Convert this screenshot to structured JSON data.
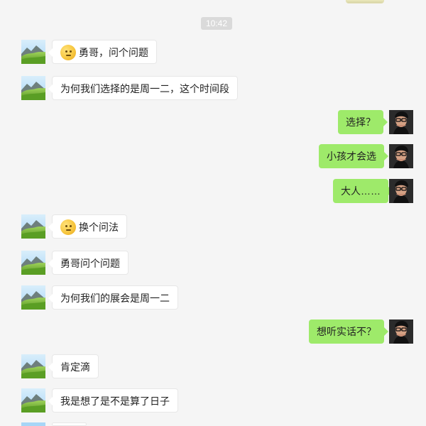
{
  "window": {
    "title": "WeChat chat",
    "timestamp": "10:42"
  },
  "messages": [
    {
      "side": "left",
      "emoji": true,
      "text": "勇哥，问个问题"
    },
    {
      "side": "left",
      "emoji": false,
      "text": "为何我们选择的是周一二，这个时间段"
    },
    {
      "side": "right",
      "emoji": false,
      "text": "选择？"
    },
    {
      "side": "right",
      "emoji": false,
      "text": "小孩才会选"
    },
    {
      "side": "right",
      "emoji": false,
      "text": "大人……"
    },
    {
      "side": "left",
      "emoji": true,
      "text": "换个问法"
    },
    {
      "side": "left",
      "emoji": false,
      "text": "勇哥问个问题"
    },
    {
      "side": "left",
      "emoji": false,
      "text": "为何我们的展会是周一二"
    },
    {
      "side": "right",
      "emoji": false,
      "text": "想听实话不？"
    },
    {
      "side": "left",
      "emoji": false,
      "text": "肯定滴"
    },
    {
      "side": "left",
      "emoji": false,
      "text": "我是想了是不是算了日子"
    }
  ],
  "icons": {
    "left_avatar": "mountain-landscape-icon",
    "right_avatar": "portrait-icon",
    "emoji": "thinking-face-emoji"
  },
  "colors": {
    "background": "#f5f5f5",
    "left_bubble": "#ffffff",
    "right_bubble": "#9eea6a",
    "timestamp_bg": "#dadada"
  }
}
